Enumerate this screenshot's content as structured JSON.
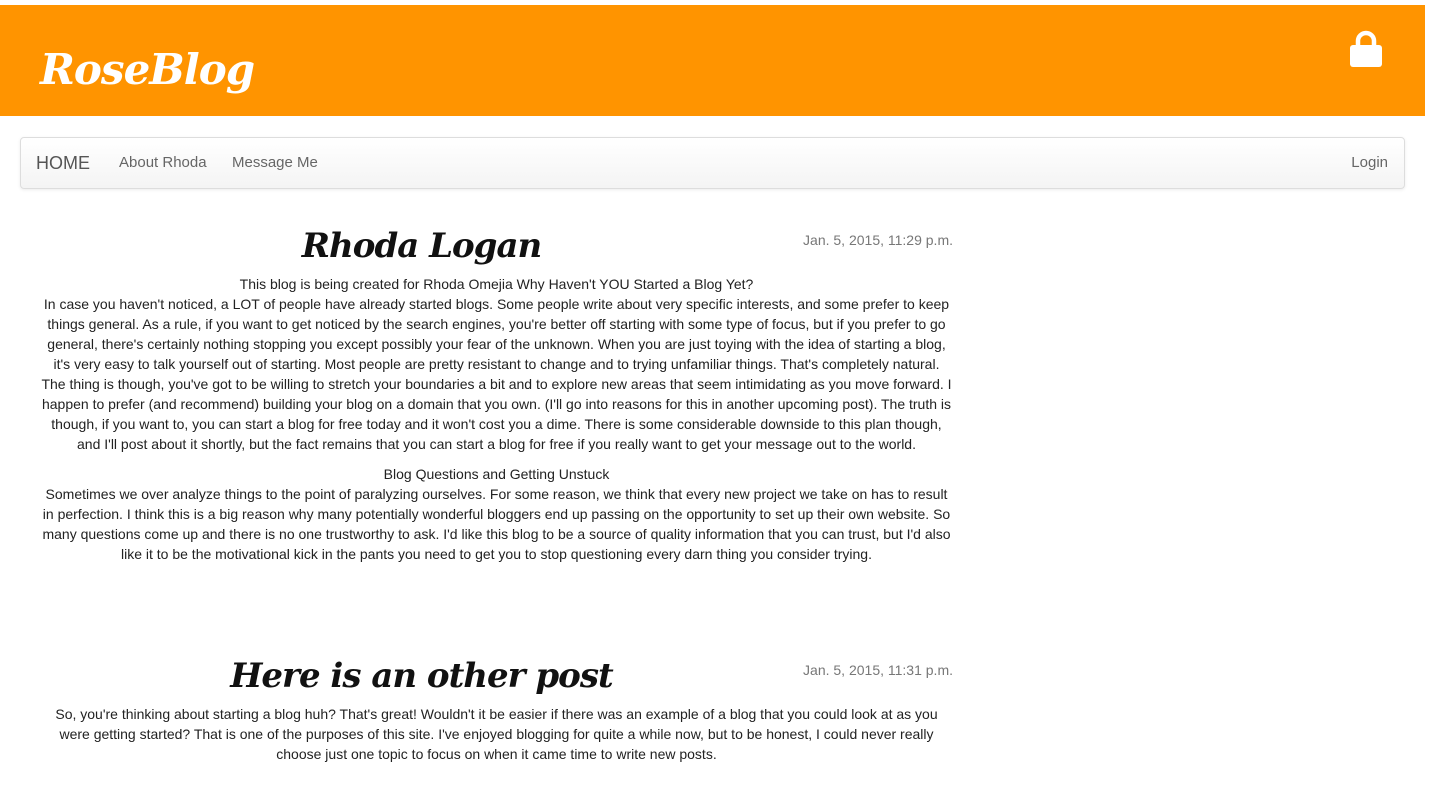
{
  "header": {
    "brand": "RoseBlog",
    "lock_icon": "lock-icon",
    "background_color": "#ff9400"
  },
  "nav": {
    "home": "HOME",
    "about": "About Rhoda",
    "message": "Message Me",
    "login": "Login"
  },
  "posts": [
    {
      "title": "Rhoda Logan",
      "date": "Jan. 5, 2015, 11:29 p.m.",
      "paragraphs": [
        {
          "heading": "This blog is being created for Rhoda Omejia Why Haven't YOU Started a Blog Yet?",
          "text": "In case you haven't noticed, a LOT of people have already started blogs. Some people write about very specific interests, and some prefer to keep things general. As a rule, if you want to get noticed by the search engines, you're better off starting with some type of focus, but if you prefer to go general, there's certainly nothing stopping you except possibly your fear of the unknown. When you are just toying with the idea of starting a blog, it's very easy to talk yourself out of starting. Most people are pretty resistant to change and to trying unfamiliar things. That's completely natural. The thing is though, you've got to be willing to stretch your boundaries a bit and to explore new areas that seem intimidating as you move forward. I happen to prefer (and recommend) building your blog on a domain that you own. (I'll go into reasons for this in another upcoming post). The truth is though, if you want to, you can start a blog for free today and it won't cost you a dime. There is some considerable downside to this plan though, and I'll post about it shortly, but the fact remains that you can start a blog for free if you really want to get your message out to the world."
        },
        {
          "heading": "Blog Questions and Getting Unstuck",
          "text": "Sometimes we over analyze things to the point of paralyzing ourselves. For some reason, we think that every new project we take on has to result in perfection. I think this is a big reason why many potentially wonderful bloggers end up passing on the opportunity to set up their own website. So many questions come up and there is no one trustworthy to ask. I'd like this blog to be a source of quality information that you can trust, but I'd also like it to be the motivational kick in the pants you need to get you to stop questioning every darn thing you consider trying."
        }
      ]
    },
    {
      "title": "Here is an other post",
      "date": "Jan. 5, 2015, 11:31 p.m.",
      "paragraphs": [
        {
          "heading": "",
          "text": "So, you're thinking about starting a blog huh? That's great! Wouldn't it be easier if there was an example of a blog that you could look at as you were getting started? That is one of the purposes of this site. I've enjoyed blogging for quite a while now, but to be honest, I could never really choose just one topic to focus on when it came time to write new posts."
        }
      ]
    }
  ]
}
